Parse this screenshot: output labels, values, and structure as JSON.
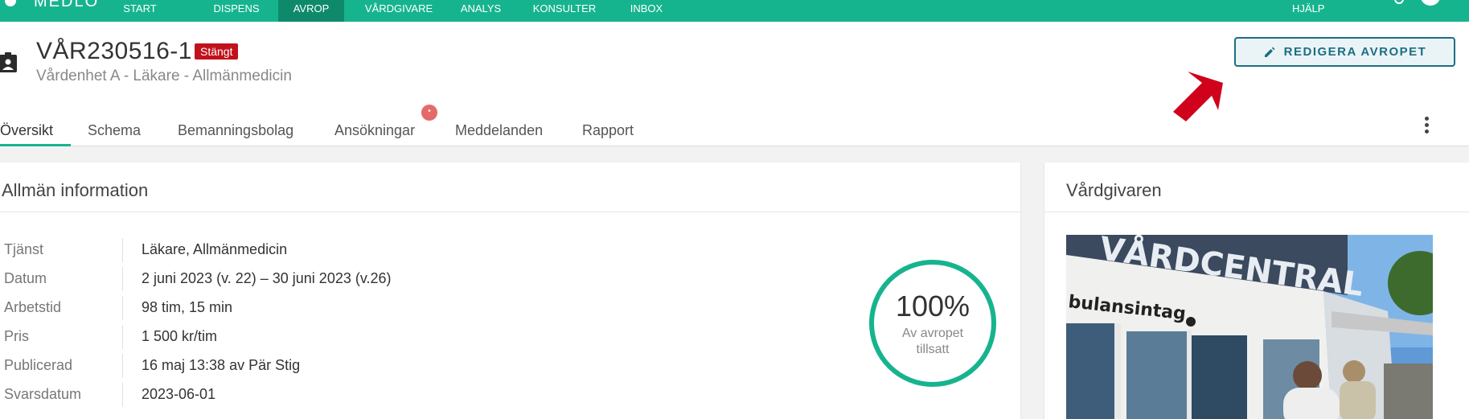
{
  "nav": {
    "brand": "MEDLO",
    "items": [
      {
        "label": "START"
      },
      {
        "label": "DISPENS"
      },
      {
        "label": "AVROP"
      },
      {
        "label": "VÅRDGIVARE"
      },
      {
        "label": "ANALYS"
      },
      {
        "label": "KONSULTER"
      },
      {
        "label": "INBOX"
      }
    ],
    "active_index": 2,
    "help": "HJÄLP"
  },
  "header": {
    "title": "VÅR230516-1",
    "status": "Stängt",
    "subtitle": "Vårdenhet A - Läkare - Allmänmedicin",
    "edit_button": "REDIGERA AVROPET"
  },
  "tabs": [
    {
      "label": "Översikt"
    },
    {
      "label": "Schema"
    },
    {
      "label": "Bemanningsbolag"
    },
    {
      "label": "Ansökningar"
    },
    {
      "label": "Meddelanden"
    },
    {
      "label": "Rapport"
    }
  ],
  "general_info": {
    "title": "Allmän information",
    "rows": [
      {
        "label": "Tjänst",
        "value": "Läkare, Allmänmedicin"
      },
      {
        "label": "Datum",
        "value": "2 juni 2023 (v. 22) – 30 juni 2023 (v.26)"
      },
      {
        "label": "Arbetstid",
        "value": "98 tim, 15 min"
      },
      {
        "label": "Pris",
        "value": "1 500 kr/tim"
      },
      {
        "label": "Publicerad",
        "value": "16 maj 13:38 av Pär Stig"
      },
      {
        "label": "Svarsdatum",
        "value": "2023-06-01"
      }
    ],
    "fill": {
      "value": "100%",
      "caption_line1": "Av avropet",
      "caption_line2": "tillsatt",
      "fraction": 1.0
    }
  },
  "care_provider": {
    "title": "Vårdgivaren",
    "photo_sign": "VÅRDCENTRAL",
    "photo_sign2": "bulansintag"
  },
  "colors": {
    "brand": "#16b48e",
    "nav_active": "#0e8a6b",
    "status_red": "#c1121c",
    "button_blue": "#1d6e82",
    "arrow_red": "#d0021b"
  },
  "icons": {
    "header": "badge-icon",
    "edit": "pencil-icon",
    "more": "more-vertical-icon"
  }
}
